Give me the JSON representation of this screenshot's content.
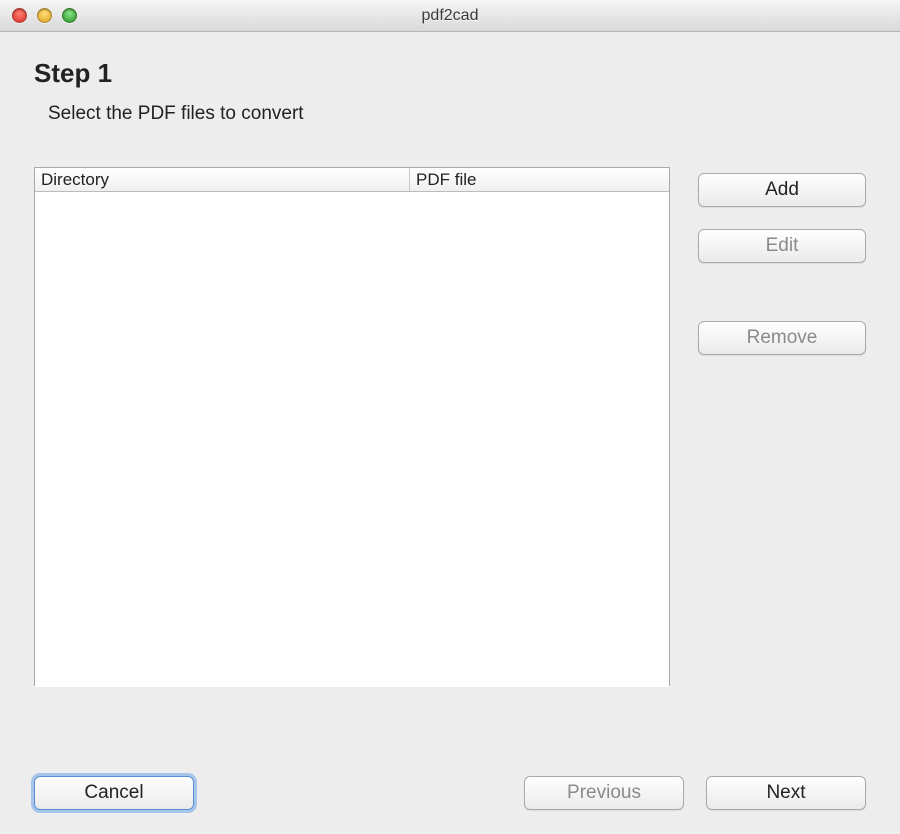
{
  "window": {
    "title": "pdf2cad"
  },
  "step": {
    "title": "Step 1",
    "subtitle": "Select the PDF files to convert"
  },
  "table": {
    "columns": {
      "directory": "Directory",
      "file": "PDF file"
    },
    "rows": []
  },
  "sideButtons": {
    "add": "Add",
    "edit": "Edit",
    "remove": "Remove"
  },
  "footerButtons": {
    "cancel": "Cancel",
    "previous": "Previous",
    "next": "Next"
  }
}
